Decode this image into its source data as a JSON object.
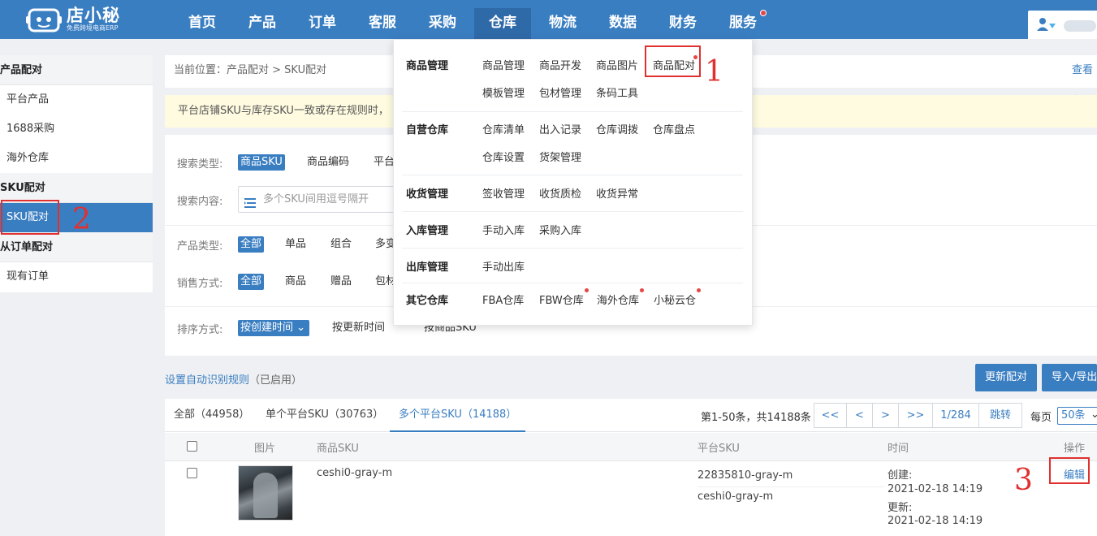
{
  "app": {
    "logo_main": "店小秘",
    "logo_sub": "免费跨境电商ERP",
    "colors": {
      "primary": "#3a7ec2",
      "active_nav": "#2f6aa8",
      "notice_bg": "#fffbe0",
      "annotation": "#e03030",
      "dot": "#e84545"
    }
  },
  "nav": {
    "items": [
      "首页",
      "产品",
      "订单",
      "客服",
      "采购",
      "仓库",
      "物流",
      "数据",
      "财务",
      "服务"
    ],
    "active": "仓库"
  },
  "sidebar": {
    "group1": "产品配对",
    "group1_items": [
      "平台产品",
      "1688采购",
      "海外仓库"
    ],
    "group2": "SKU配对",
    "group2_items": [
      "SKU配对"
    ],
    "group3": "从订单配对",
    "group3_items": [
      "现有订单"
    ]
  },
  "breadcrumb": {
    "text": "当前位置：产品配对 > SKU配对",
    "help": "查看帮"
  },
  "notice": "平台店铺SKU与库存SKU一致或存在规则时，",
  "filters": {
    "search_type_label": "搜索类型:",
    "search_type_options": [
      "商品SKU",
      "商品编码",
      "平台"
    ],
    "search_content_label": "搜索内容:",
    "search_placeholder": "多个SKU间用逗号隔开",
    "product_type_label": "产品类型:",
    "product_type_options": [
      "全部",
      "单品",
      "组合",
      "多变"
    ],
    "sale_mode_label": "销售方式:",
    "sale_mode_options": [
      "全部",
      "商品",
      "赠品",
      "包材"
    ],
    "sort_label": "排序方式:",
    "sort_options": [
      "按创建时间",
      "按更新时间",
      "按商品SKU"
    ]
  },
  "actions": {
    "rule_link": "设置自动识别规则",
    "rule_status": "（已启用）",
    "update_pairing": "更新配对",
    "import_export": "导入/导出"
  },
  "tabs": [
    "全部（44958）",
    "单个平台SKU（30763）",
    "多个平台SKU（14188）"
  ],
  "pagination": {
    "info": "第1-50条，共14188条",
    "first": "<<",
    "prev": "<",
    "next": ">",
    "last": ">>",
    "page": "1/284",
    "jump": "跳转",
    "per_page_label": "每页",
    "per_page_value": "50条"
  },
  "table": {
    "headers": [
      "图片",
      "商品SKU",
      "平台SKU",
      "时间",
      "操作"
    ],
    "row": {
      "sku": "ceshi0-gray-m",
      "platform_skus": [
        "22835810-gray-m",
        "ceshi0-gray-m"
      ],
      "created_label": "创建:",
      "created": "2021-02-18 14:19",
      "updated_label": "更新:",
      "updated": "2021-02-18 14:19",
      "edit": "编辑"
    }
  },
  "mega_menu": {
    "sections": [
      {
        "title": "商品管理",
        "links": [
          "商品管理",
          "商品开发",
          "商品图片",
          "商品配对",
          "模板管理",
          "包材管理",
          "条码工具"
        ]
      },
      {
        "title": "自营仓库",
        "links": [
          "仓库清单",
          "出入记录",
          "仓库调拨",
          "仓库盘点",
          "仓库设置",
          "货架管理"
        ]
      },
      {
        "title": "收货管理",
        "links": [
          "签收管理",
          "收货质检",
          "收货异常"
        ]
      },
      {
        "title": "入库管理",
        "links": [
          "手动入库",
          "采购入库"
        ]
      },
      {
        "title": "出库管理",
        "links": [
          "手动出库"
        ]
      },
      {
        "title": "其它仓库",
        "links": [
          "FBA仓库",
          "FBW仓库",
          "海外仓库",
          "小秘云仓"
        ]
      }
    ]
  },
  "annotations": [
    "1",
    "2",
    "3"
  ]
}
